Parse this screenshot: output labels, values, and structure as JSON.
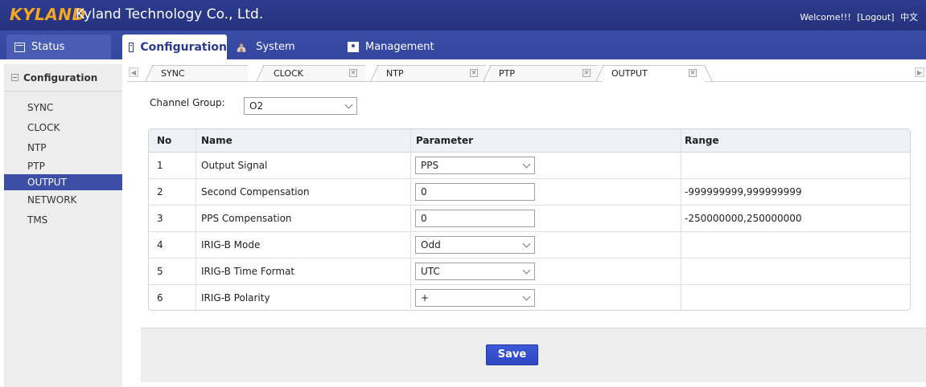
{
  "header": {
    "logo": "KYLAND",
    "company": "Kyland Technology Co., Ltd.",
    "welcome": "Welcome!!!",
    "logout": "[Logout]",
    "language": "中文"
  },
  "nav": {
    "status": "Status",
    "configuration": "Configuration",
    "system": "System",
    "management": "Management"
  },
  "sidebar": {
    "title": "Configuration",
    "items": [
      {
        "label": "SYNC"
      },
      {
        "label": "CLOCK"
      },
      {
        "label": "NTP"
      },
      {
        "label": "PTP"
      },
      {
        "label": "OUTPUT",
        "active": true
      },
      {
        "label": "NETWORK"
      },
      {
        "label": "TMS"
      }
    ]
  },
  "subtabs": [
    {
      "label": "SYNC"
    },
    {
      "label": "CLOCK"
    },
    {
      "label": "NTP"
    },
    {
      "label": "PTP"
    },
    {
      "label": "OUTPUT",
      "selected": true
    }
  ],
  "channel_group": {
    "label": "Channel Group:",
    "value": "O2"
  },
  "table": {
    "headers": [
      "No",
      "Name",
      "Parameter",
      "Range"
    ],
    "rows": [
      {
        "no": "1",
        "name": "Output Signal",
        "param": "PPS",
        "param_type": "select",
        "range": ""
      },
      {
        "no": "2",
        "name": "Second Compensation",
        "param": "0",
        "param_type": "text",
        "range": "-999999999,999999999"
      },
      {
        "no": "3",
        "name": "PPS Compensation",
        "param": "0",
        "param_type": "text",
        "range": "-250000000,250000000"
      },
      {
        "no": "4",
        "name": "IRIG-B Mode",
        "param": "Odd",
        "param_type": "select",
        "range": ""
      },
      {
        "no": "5",
        "name": "IRIG-B Time Format",
        "param": "UTC",
        "param_type": "select",
        "range": ""
      },
      {
        "no": "6",
        "name": "IRIG-B Polarity",
        "param": "+",
        "param_type": "select",
        "range": ""
      }
    ]
  },
  "save_label": "Save",
  "colors": {
    "header_bg": "#25327c",
    "nav_bg": "#3347a0",
    "logo": "#f5a623",
    "active_item": "#3c4ea6",
    "save_button": "#2e47c4"
  }
}
